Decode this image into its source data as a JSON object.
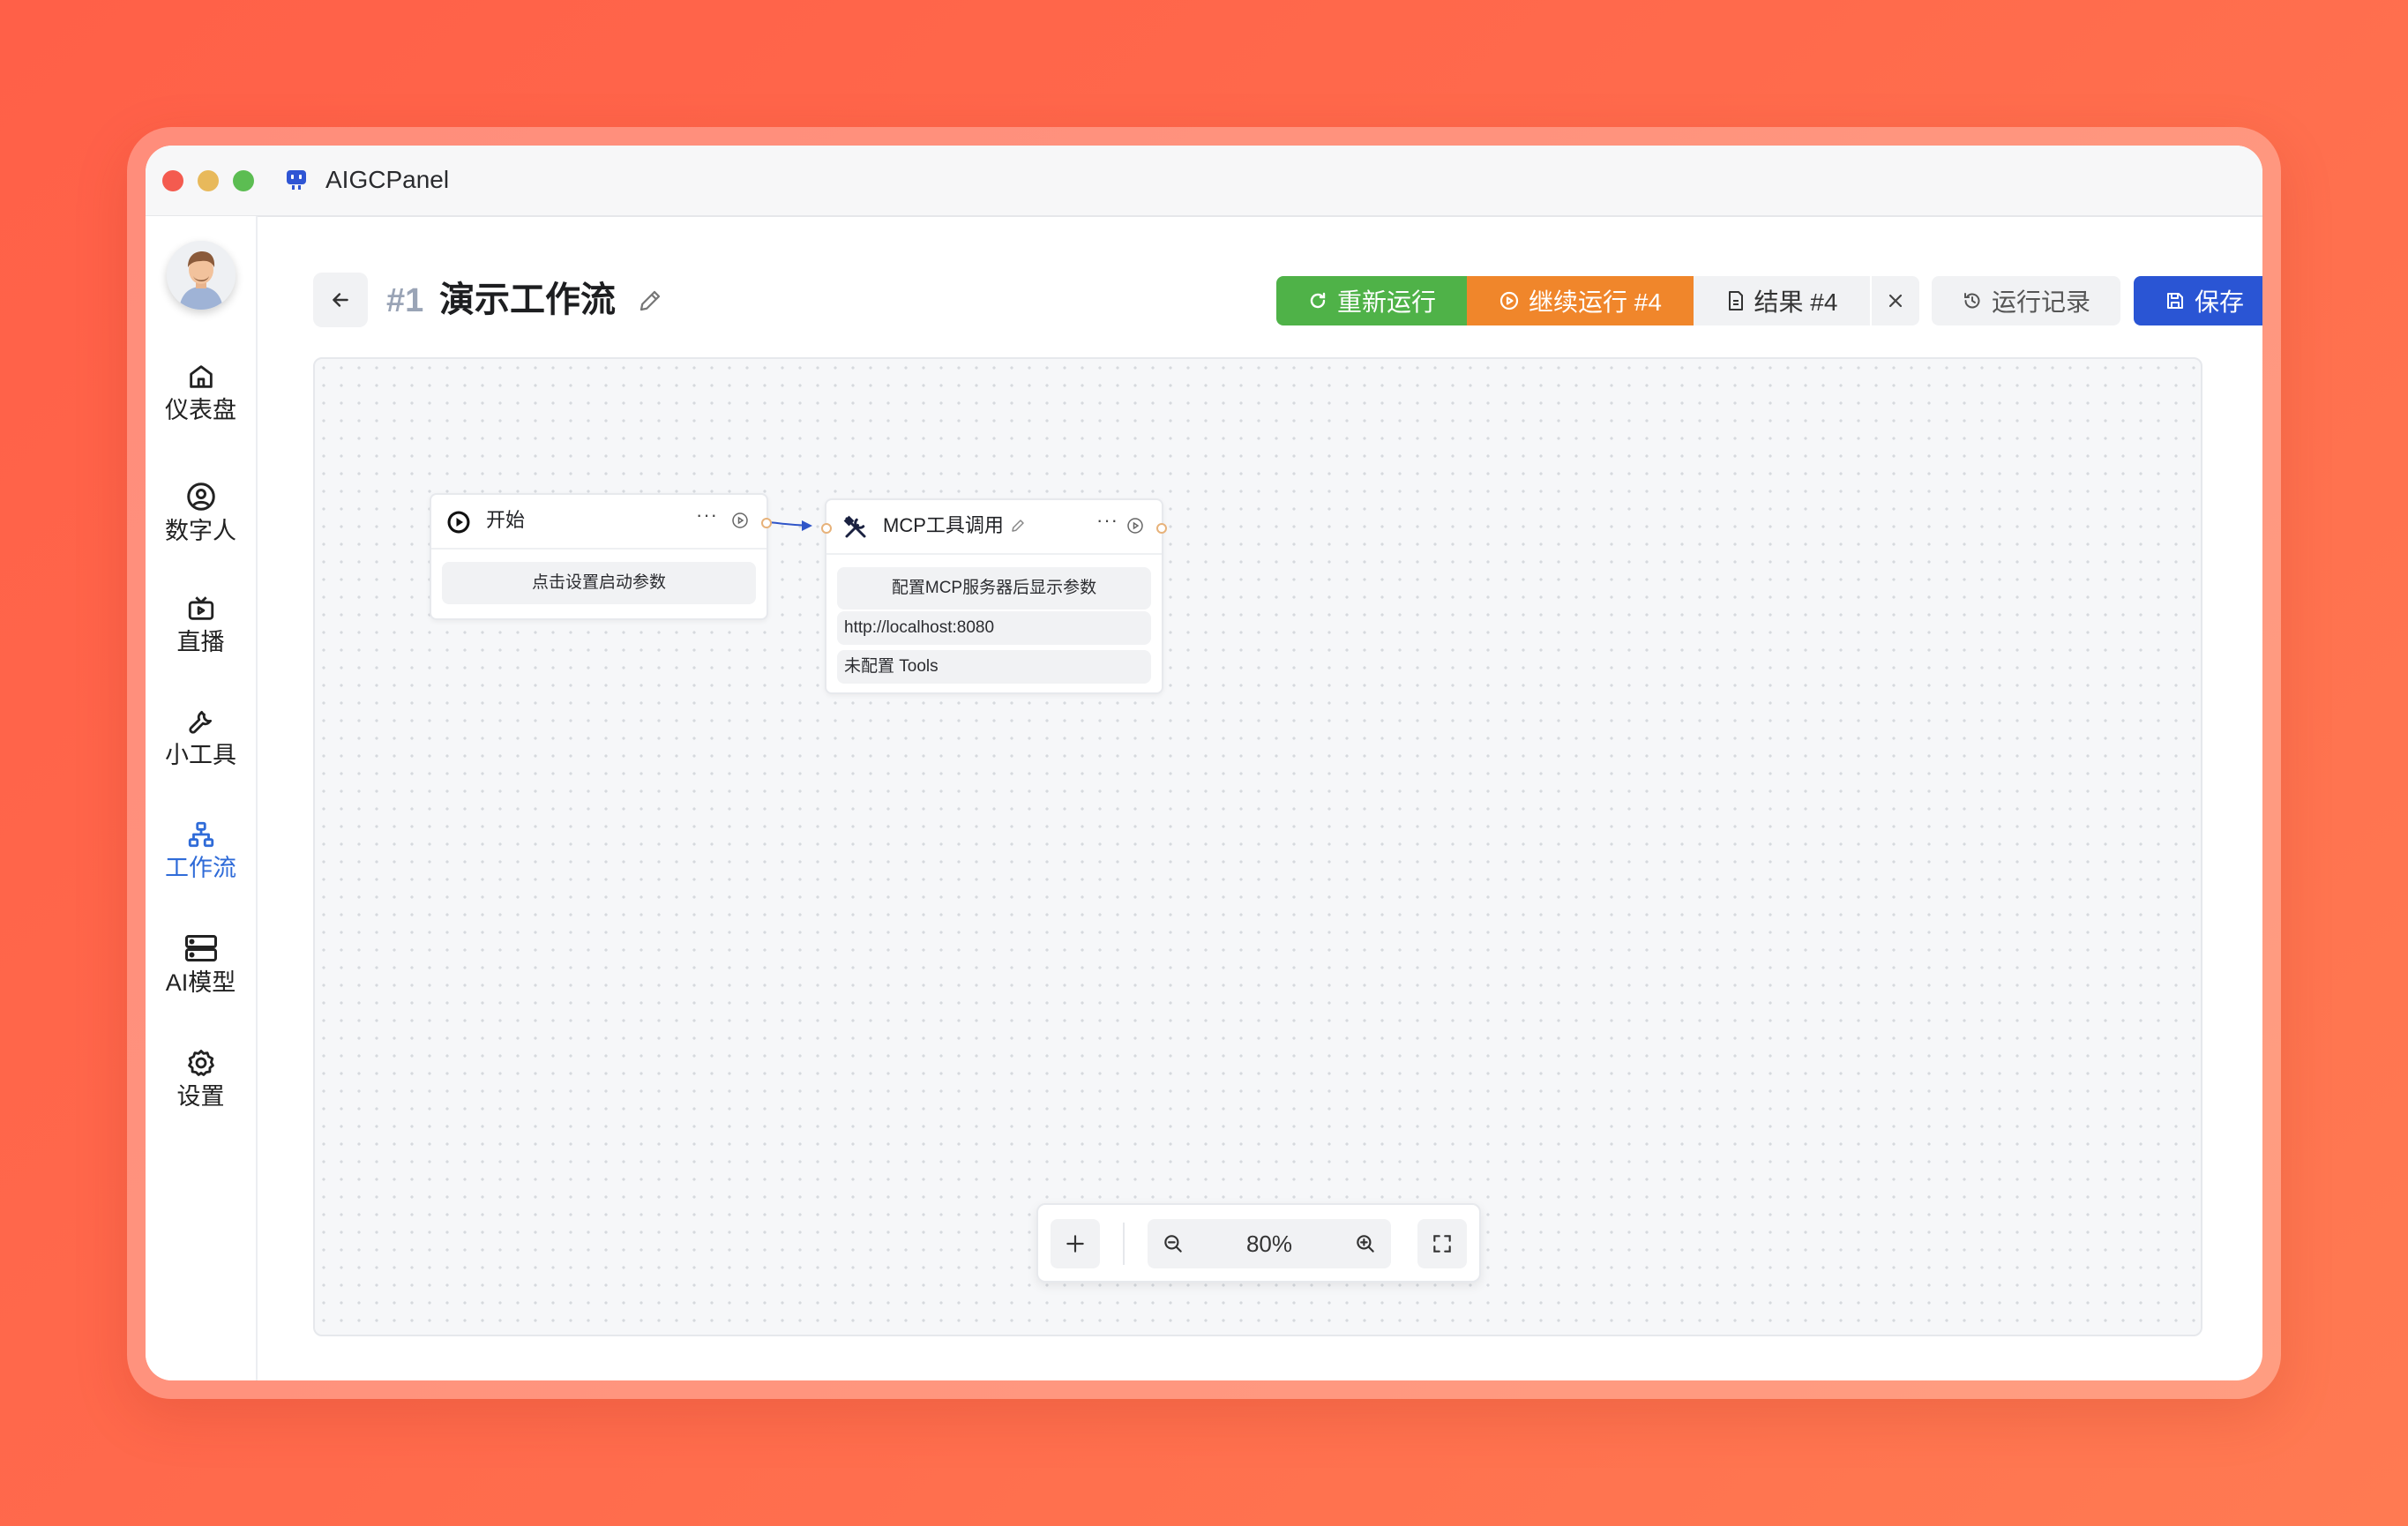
{
  "app": {
    "title": "AIGCPanel"
  },
  "sidebar": {
    "items": [
      {
        "label": "仪表盘",
        "icon": "home-icon"
      },
      {
        "label": "数字人",
        "icon": "user-circle-icon"
      },
      {
        "label": "直播",
        "icon": "tv-icon"
      },
      {
        "label": "小工具",
        "icon": "wrench-icon"
      },
      {
        "label": "工作流",
        "icon": "workflow-icon",
        "active": true
      },
      {
        "label": "AI模型",
        "icon": "server-icon"
      },
      {
        "label": "设置",
        "icon": "gear-icon"
      }
    ]
  },
  "header": {
    "number": "#1",
    "title": "演示工作流",
    "buttons": {
      "rerun": "重新运行",
      "continue": "继续运行 #4",
      "result": "结果 #4",
      "history": "运行记录",
      "save": "保存"
    }
  },
  "nodes": {
    "start": {
      "title": "开始",
      "field": "点击设置启动参数"
    },
    "mcp": {
      "title": "MCP工具调用",
      "note": "配置MCP服务器后显示参数",
      "url": "http://localhost:8080",
      "tools": "未配置 Tools"
    }
  },
  "zoom": {
    "value": "80%"
  },
  "colors": {
    "rerun": "#4fb248",
    "continue": "#f0862b",
    "save": "#2a55d4",
    "active_nav": "#2f6bd8",
    "edge": "#2f55c8"
  }
}
